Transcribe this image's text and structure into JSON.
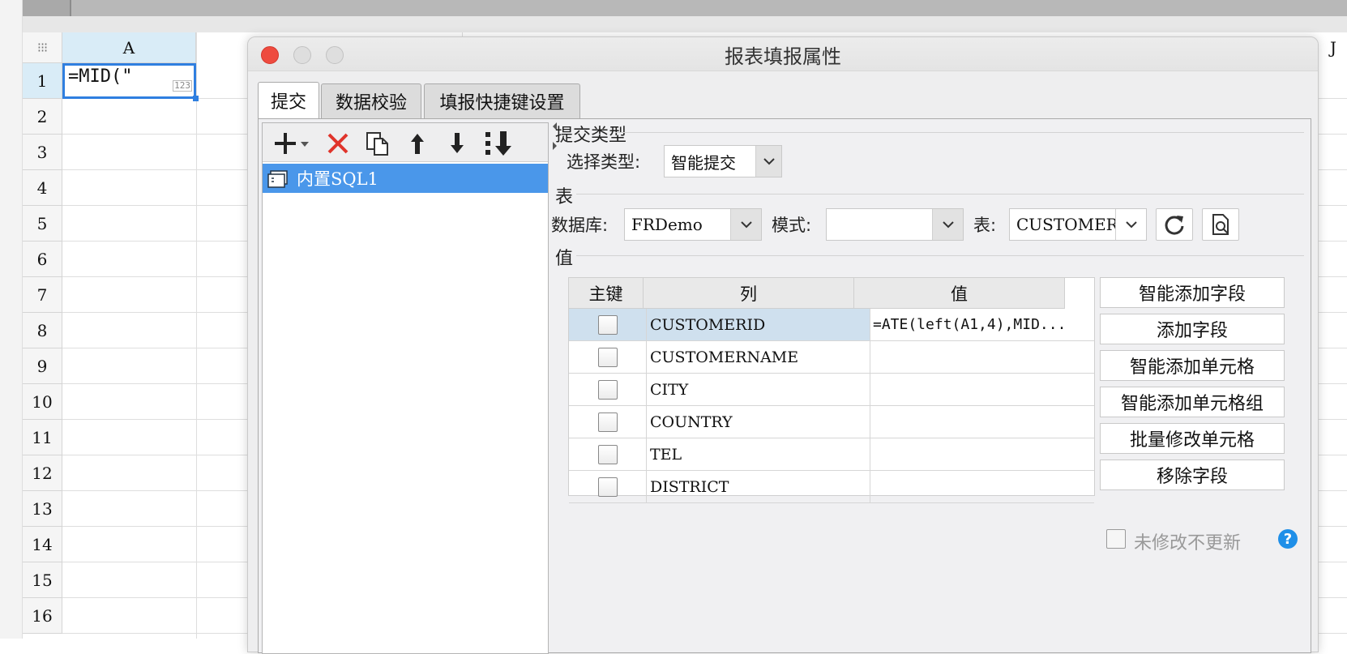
{
  "spreadsheet": {
    "corner_label": "⁝⁝⁝",
    "columns": [
      "A",
      "J"
    ],
    "rows": [
      "1",
      "2",
      "3",
      "4",
      "5",
      "6",
      "7",
      "8",
      "9",
      "10",
      "11",
      "12",
      "13",
      "14",
      "15",
      "16"
    ],
    "cell_a1": {
      "value": "=MID(\"",
      "badge": "123"
    }
  },
  "dialog": {
    "title": "报表填报属性",
    "tabs": [
      "提交",
      "数据校验",
      "填报快捷键设置"
    ],
    "list": {
      "items": [
        {
          "label": "内置SQL1"
        }
      ]
    },
    "submit_type": {
      "section_label": "提交类型",
      "select_label": "选择类型:",
      "selected": "智能提交"
    },
    "table_section": {
      "section_label": "表",
      "database_label": "数据库:",
      "database_value": "FRDemo",
      "schema_label": "模式:",
      "schema_value": "",
      "table_label": "表:",
      "table_value": "CUSTOMER"
    },
    "values_section": {
      "section_label": "值",
      "headers": [
        "主键",
        "列",
        "值"
      ],
      "rows": [
        {
          "column": "CUSTOMERID",
          "value": "=ATE(left(A1,4),MID..."
        },
        {
          "column": "CUSTOMERNAME",
          "value": ""
        },
        {
          "column": "CITY",
          "value": ""
        },
        {
          "column": "COUNTRY",
          "value": ""
        },
        {
          "column": "TEL",
          "value": ""
        },
        {
          "column": "DISTRICT",
          "value": ""
        }
      ],
      "side_buttons": [
        "智能添加字段",
        "添加字段",
        "智能添加单元格",
        "智能添加单元格组",
        "批量修改单元格",
        "移除字段"
      ],
      "unmodified_checkbox_label": "未修改不更新"
    }
  },
  "colors": {
    "accent": "#4a97ea",
    "selection": "#cfe0ee",
    "delete": "#e0342b",
    "help": "#1f8fe8"
  }
}
